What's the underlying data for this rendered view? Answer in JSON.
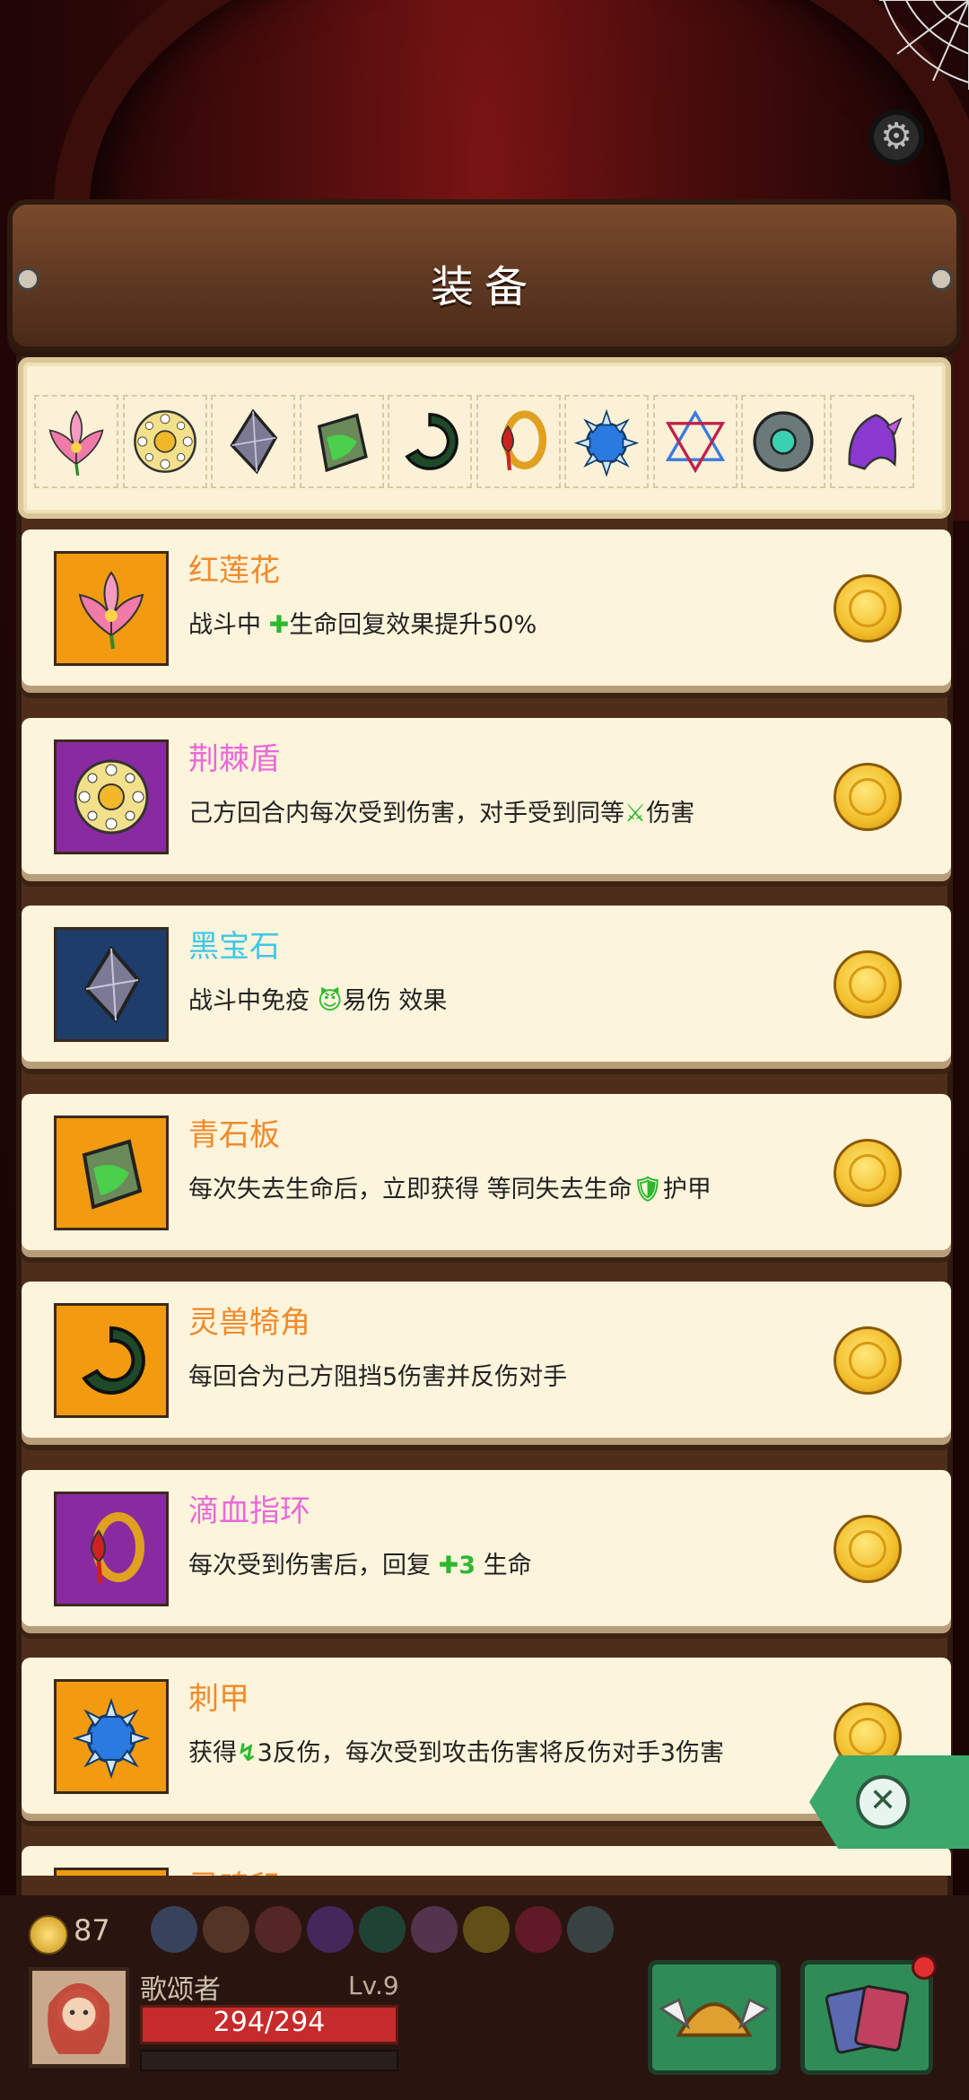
{
  "header": {
    "title": "装备"
  },
  "strip_items": [
    {
      "icon": "red-lotus-icon"
    },
    {
      "icon": "thorn-shield-icon"
    },
    {
      "icon": "black-gem-icon"
    },
    {
      "icon": "green-slate-icon"
    },
    {
      "icon": "beast-horn-icon"
    },
    {
      "icon": "blood-ring-icon"
    },
    {
      "icon": "spike-armor-icon"
    },
    {
      "icon": "hexagram-icon"
    },
    {
      "icon": "stone-disc-icon"
    },
    {
      "icon": "purple-hood-icon"
    }
  ],
  "equipment": [
    {
      "name": "红莲花",
      "name_color": "#f08a2a",
      "rarity_color": "#f29a10",
      "icon": "red-lotus-icon",
      "desc_parts": [
        "战斗中 ",
        "✚",
        "生命回复效果提升50%"
      ]
    },
    {
      "name": "荆棘盾",
      "name_color": "#e86ad8",
      "rarity_color": "#8a2aa0",
      "icon": "thorn-shield-icon",
      "desc_parts": [
        "己方回合内每次受到伤害，对手受到同等",
        "⚔",
        "伤害"
      ]
    },
    {
      "name": "黑宝石",
      "name_color": "#3ec7e8",
      "rarity_color": "#1f3d6a",
      "icon": "black-gem-icon",
      "desc_parts": [
        "战斗中免疫 ",
        "😈",
        "易伤 效果"
      ]
    },
    {
      "name": "青石板",
      "name_color": "#f08a2a",
      "rarity_color": "#f29a10",
      "icon": "green-slate-icon",
      "desc_parts": [
        "每次失去生命后，立即获得 等同失去生命",
        "🛡",
        "护甲"
      ]
    },
    {
      "name": "灵兽犄角",
      "name_color": "#f08a2a",
      "rarity_color": "#f29a10",
      "icon": "beast-horn-icon",
      "desc_parts": [
        "每回合为己方阻挡5伤害并反伤对手",
        "",
        ""
      ]
    },
    {
      "name": "滴血指环",
      "name_color": "#e86ad8",
      "rarity_color": "#8a2aa0",
      "icon": "blood-ring-icon",
      "desc_parts": [
        "每次受到伤害后，回复 ",
        "✚3",
        " 生命"
      ]
    },
    {
      "name": "刺甲",
      "name_color": "#f08a2a",
      "rarity_color": "#f29a10",
      "icon": "spike-armor-icon",
      "desc_parts": [
        "获得",
        "↯",
        "3反伤，每次受到攻击伤害将反伤对手3伤害"
      ]
    },
    {
      "name": "灵魂印",
      "name_color": "#f08a2a",
      "rarity_color": "#f29a10",
      "icon": "hexagram-icon",
      "desc_parts": [
        "",
        "",
        ""
      ]
    }
  ],
  "hud": {
    "gold": "87",
    "player_name": "歌颂者",
    "level": "Lv.9",
    "hp": "294/294",
    "exp_fraction": 0.0
  },
  "colors": {
    "parchment": "#fdf4dc",
    "wood": "#5c3620",
    "close_tab": "#3aa86a"
  }
}
